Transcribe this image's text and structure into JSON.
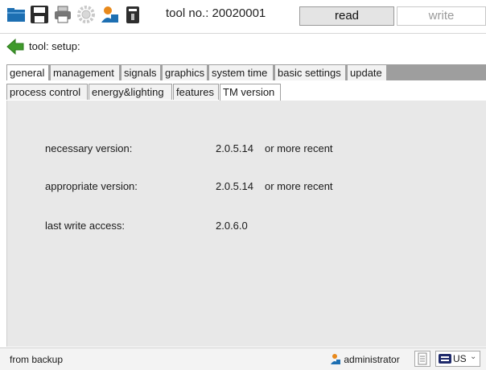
{
  "toolbar": {
    "title": "tool no.: 20020001",
    "read_label": "read",
    "write_label": "write",
    "icons": [
      "folder-icon",
      "save-icon",
      "print-icon",
      "gear-icon",
      "user-icon",
      "tool-icon"
    ]
  },
  "breadcrumb": {
    "label": "tool: setup:"
  },
  "tabs_main": [
    "general",
    "management",
    "signals",
    "graphics",
    "system time",
    "basic settings",
    "update"
  ],
  "tabs_sub": [
    "process control",
    "energy&lighting",
    "features",
    "TM version"
  ],
  "content": {
    "rows": [
      {
        "label": "necessary version:",
        "value": "2.0.5.14",
        "note": "or more recent"
      },
      {
        "label": "appropriate version:",
        "value": "2.0.5.14",
        "note": "or more recent"
      },
      {
        "label": "last write access:",
        "value": "2.0.6.0",
        "note": ""
      }
    ]
  },
  "status": {
    "text": "from backup",
    "user": "administrator",
    "language": "US"
  },
  "colors": {
    "accent_green": "#3f9a2b",
    "folder_blue": "#1d6fb2",
    "tab_bar_bg": "#9e9e9e",
    "content_bg": "#e8e8e8"
  }
}
